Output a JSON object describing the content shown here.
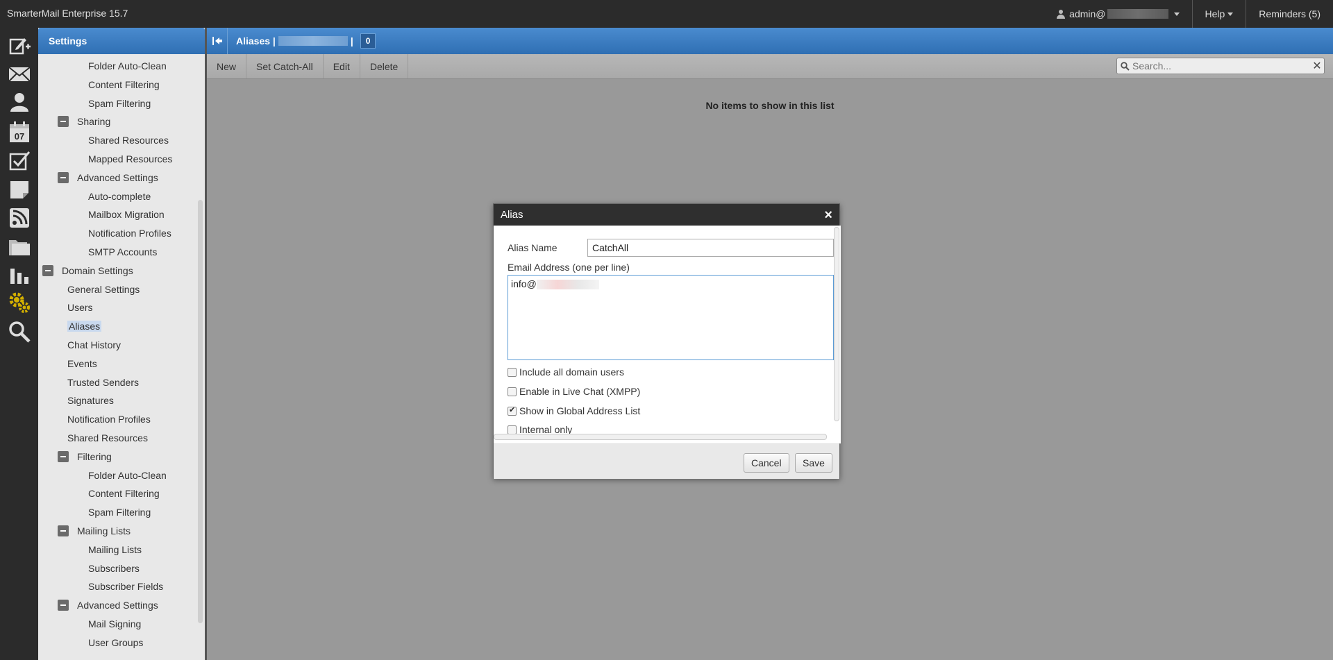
{
  "app": {
    "title": "SmarterMail Enterprise 15.7"
  },
  "topbar": {
    "user_label": "admin@",
    "help_label": "Help",
    "reminders_label": "Reminders (5)"
  },
  "rail": {
    "items": [
      "compose-icon",
      "mail-icon",
      "contacts-icon",
      "calendar-icon",
      "tasks-icon",
      "notes-icon",
      "rss-icon",
      "files-icon",
      "reports-icon",
      "settings-icon",
      "search-icon"
    ],
    "calendar_day": "07"
  },
  "settings": {
    "header": "Settings",
    "tree": [
      {
        "label": "Folder Auto-Clean",
        "level": 2
      },
      {
        "label": "Content Filtering",
        "level": 2
      },
      {
        "label": "Spam Filtering",
        "level": 2
      },
      {
        "label": "Sharing",
        "level": 1,
        "toggle": true
      },
      {
        "label": "Shared Resources",
        "level": 2
      },
      {
        "label": "Mapped Resources",
        "level": 2
      },
      {
        "label": "Advanced Settings",
        "level": 1,
        "toggle": true
      },
      {
        "label": "Auto-complete",
        "level": 2
      },
      {
        "label": "Mailbox Migration",
        "level": 2
      },
      {
        "label": "Notification Profiles",
        "level": 2
      },
      {
        "label": "SMTP Accounts",
        "level": 2
      },
      {
        "label": "Domain Settings",
        "level": 0,
        "toggle": true
      },
      {
        "label": "General Settings",
        "level": 1
      },
      {
        "label": "Users",
        "level": 1
      },
      {
        "label": "Aliases",
        "level": 1,
        "selected": true
      },
      {
        "label": "Chat History",
        "level": 1
      },
      {
        "label": "Events",
        "level": 1
      },
      {
        "label": "Trusted Senders",
        "level": 1
      },
      {
        "label": "Signatures",
        "level": 1
      },
      {
        "label": "Notification Profiles",
        "level": 1
      },
      {
        "label": "Shared Resources",
        "level": 1
      },
      {
        "label": "Filtering",
        "level": 1,
        "toggle": true
      },
      {
        "label": "Folder Auto-Clean",
        "level": 2
      },
      {
        "label": "Content Filtering",
        "level": 2
      },
      {
        "label": "Spam Filtering",
        "level": 2
      },
      {
        "label": "Mailing Lists",
        "level": 1,
        "toggle": true
      },
      {
        "label": "Mailing Lists",
        "level": 2
      },
      {
        "label": "Subscribers",
        "level": 2
      },
      {
        "label": "Subscriber Fields",
        "level": 2
      },
      {
        "label": "Advanced Settings",
        "level": 1,
        "toggle": true
      },
      {
        "label": "Mail Signing",
        "level": 2
      },
      {
        "label": "User Groups",
        "level": 2
      }
    ]
  },
  "main": {
    "title_prefix": "Aliases |",
    "title_suffix": "|",
    "count": "0",
    "toolbar": {
      "new": "New",
      "set_catch_all": "Set Catch-All",
      "edit": "Edit",
      "delete": "Delete"
    },
    "search": {
      "placeholder": "Search...",
      "value": ""
    },
    "empty_message": "No items to show in this list"
  },
  "modal": {
    "title": "Alias",
    "alias_name_label": "Alias Name",
    "alias_name_value": "CatchAll",
    "email_label": "Email Address (one per line)",
    "email_value": "info@",
    "checkboxes": [
      {
        "label": "Include all domain users",
        "checked": false
      },
      {
        "label": "Enable in Live Chat (XMPP)",
        "checked": false
      },
      {
        "label": "Show in Global Address List",
        "checked": true
      },
      {
        "label": "Internal only",
        "checked": false
      }
    ],
    "cancel_label": "Cancel",
    "save_label": "Save"
  }
}
